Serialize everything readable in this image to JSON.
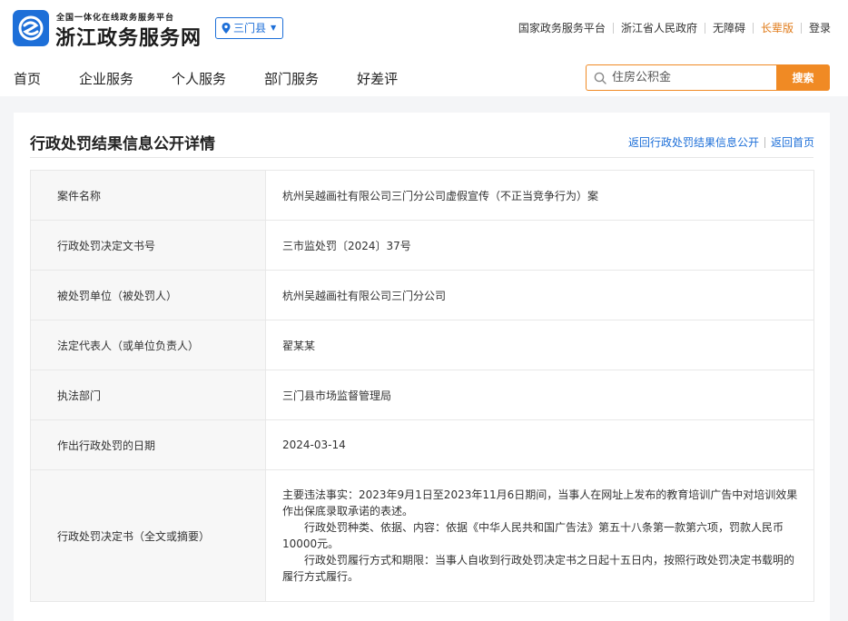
{
  "header": {
    "brand_sub": "全国一体化在线政务服务平台",
    "brand_main": "浙江政务服务网",
    "region": "三门县",
    "top_links": [
      "国家政务服务平台",
      "浙江省人民政府",
      "无障碍",
      "长辈版",
      "登录"
    ],
    "nav": [
      "首页",
      "企业服务",
      "个人服务",
      "部门服务",
      "好差评"
    ],
    "search": {
      "placeholder": "住房公积金",
      "button": "搜索"
    },
    "colors": {
      "brand": "#1d6fd8",
      "accent": "#f08a24",
      "elder_link": "#e07b1a"
    }
  },
  "main": {
    "title": "行政处罚结果信息公开详情",
    "links": [
      "返回行政处罚结果信息公开",
      "返回首页"
    ],
    "rows": [
      {
        "label": "案件名称",
        "value": "杭州吴越画社有限公司三门分公司虚假宣传（不正当竞争行为）案"
      },
      {
        "label": "行政处罚决定文书号",
        "value": "三市监处罚〔2024〕37号"
      },
      {
        "label": "被处罚单位（被处罚人）",
        "value": "杭州吴越画社有限公司三门分公司"
      },
      {
        "label": "法定代表人（或单位负责人）",
        "value": "翟某某"
      },
      {
        "label": "执法部门",
        "value": "三门县市场监督管理局"
      },
      {
        "label": "作出行政处罚的日期",
        "value": "2024-03-14"
      }
    ],
    "decision": {
      "label": "行政处罚决定书（全文或摘要）",
      "paragraphs": [
        "主要违法事实：2023年9月1日至2023年11月6日期间，当事人在网址上发布的教育培训广告中对培训效果作出保底录取承诺的表述。",
        "行政处罚种类、依据、内容：依据《中华人民共和国广告法》第五十八条第一款第六项，罚款人民币10000元。",
        "行政处罚履行方式和期限：当事人自收到行政处罚决定书之日起十五日内，按照行政处罚决定书载明的履行方式履行。"
      ]
    }
  }
}
